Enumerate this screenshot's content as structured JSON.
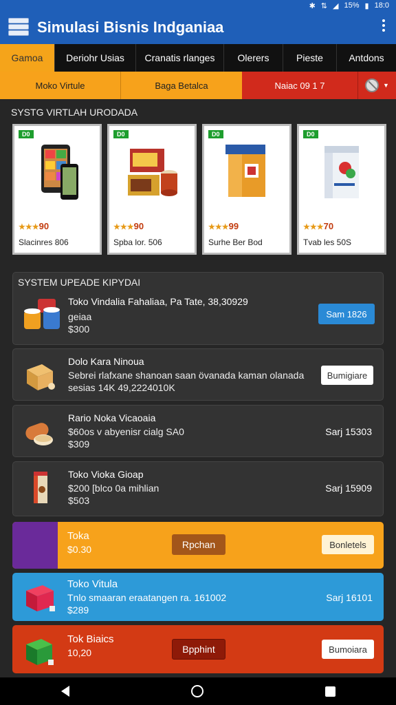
{
  "status": {
    "signal": "⇅",
    "battery_pct": "15%",
    "time": "18:0"
  },
  "app": {
    "title": "Simulasi Bisnis Indganiaa"
  },
  "tabs": [
    {
      "label": "Gamoa",
      "active": true
    },
    {
      "label": "Deriohr Usias"
    },
    {
      "label": "Cranatis rlanges"
    },
    {
      "label": "Olerers"
    },
    {
      "label": "Pieste"
    },
    {
      "label": "Antdons"
    }
  ],
  "filters": {
    "f1": "Moko Virtule",
    "f2": "Baga Betalca",
    "f3": "Naiac 09 1 7"
  },
  "section1": {
    "title": "SYSTG VIRTLAH URODADA"
  },
  "cards": [
    {
      "badge": "D0",
      "rating": "90",
      "stars": "★★★",
      "name": "Slacinres 806"
    },
    {
      "badge": "D0",
      "rating": "90",
      "stars": "★★★",
      "name": "Spba lor. 506"
    },
    {
      "badge": "D0",
      "rating": "99",
      "stars": "★★★",
      "name": "Surhe Ber Bod"
    },
    {
      "badge": "D0",
      "rating": "70",
      "stars": "★★★",
      "name": "Tvab les 50S"
    }
  ],
  "panel": {
    "title": "SYSTEM UPEADE KIPYDAI",
    "line1": "Toko Vindalia Fahaliaa, Pa Tate, 38,30929",
    "line2": "geiaa",
    "line3": "$300",
    "button": "Sam 1826"
  },
  "rows": [
    {
      "line1": "Dolo Kara Ninoua",
      "line2": "Sebrei rlafxane shanoan saan övanada kaman olanada",
      "line3": "sesias  14K 49,2224010K",
      "button": "Bumigiare"
    },
    {
      "line1": "Rario Noka Vicaoaia",
      "line2": "$60os v abyenisr cialg SA0",
      "line3": "$309",
      "right": "Sarj 15303"
    },
    {
      "line1": "Toko Vioka Gioap",
      "line2": "$200  [blco 0a  mihlian",
      "line3": "$503",
      "right": "Sarj 15909"
    }
  ],
  "colored": [
    {
      "line1": "Toka",
      "line2": "$0.30",
      "mid_button": "Rpchan",
      "right_button": "Bonletels"
    },
    {
      "line1": "Toko Vitula",
      "line2": "Tnlo smaaran eraatangen ra. 161002",
      "line3": "$289",
      "right": "Sarj 16101"
    },
    {
      "line1": "Tok Biaics",
      "line2": "10,20",
      "mid_button": "Bpphint",
      "right_button": "Bumoiara"
    }
  ],
  "colors": {
    "primary": "#1f5fb8",
    "accent_orange": "#f7a21b",
    "accent_red": "#d12a1c",
    "accent_blue": "#2d9ad8",
    "badge_green": "#1e9e2e"
  }
}
